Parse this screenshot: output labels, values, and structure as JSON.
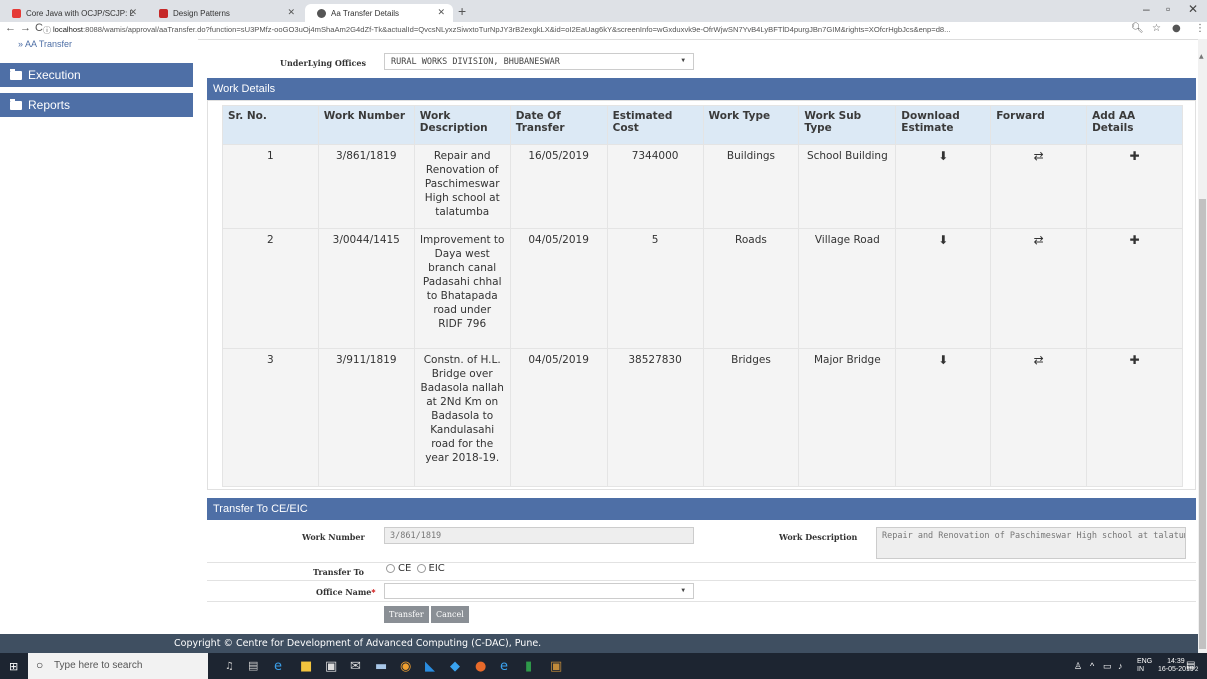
{
  "browser": {
    "tabs": [
      {
        "title": "Core Java with OCJP/SCJP: L",
        "color": "#e53935"
      },
      {
        "title": "Design Patterns",
        "color": "#c62828"
      },
      {
        "title": "Aa Transfer Details",
        "color": "#555555"
      }
    ],
    "new_tab": "+",
    "controls": {
      "minimize": "–",
      "maximize": "▫",
      "close": "✕"
    },
    "nav": {
      "back": "←",
      "forward": "→",
      "reload": "C"
    },
    "url_host": "localhost",
    "url_rest": ":8088/wamis/approval/aaTransfer.do?function=sU3PMfz-ooGO3uOj4mShaAm2G4dZf-Tk&actualId=QvcsNLyxzSiwxtoTurNpJY3rB2exgkLX&id=oI2EaUag6kY&screenInfo=wGxduxvk9e-OfrWjwSN7YvB4LyBFTlD4purgJBn7GIM&rights=XOfcrHgbJcs&enp=d8...",
    "info_icon": "ⓘ"
  },
  "sidebar": {
    "top_link": "» AA Transfer",
    "items": [
      {
        "label": "Execution"
      },
      {
        "label": "Reports"
      }
    ]
  },
  "underlying": {
    "label": "UnderLying Offices",
    "value": "RURAL WORKS DIVISION, BHUBANESWAR"
  },
  "work_details": {
    "heading": "Work Details",
    "columns": [
      "Sr. No.",
      "Work Number",
      "Work Description",
      "Date Of Transfer",
      "Estimated Cost",
      "Work Type",
      "Work Sub Type",
      "Download Estimate",
      "Forward",
      "Add AA Details"
    ],
    "rows": [
      {
        "sr": "1",
        "number": "3/861/1819",
        "description": "Repair and Renovation of Paschimeswar High school at talatumba",
        "date": "16/05/2019",
        "cost": "7344000",
        "type": "Buildings",
        "subtype": "School Building"
      },
      {
        "sr": "2",
        "number": "3/0044/1415",
        "description": "Improvement to Daya west branch canal Padasahi chhal to Bhatapada road under RIDF 796",
        "date": "04/05/2019",
        "cost": "5",
        "type": "Roads",
        "subtype": "Village Road"
      },
      {
        "sr": "3",
        "number": "3/911/1819",
        "description": "Constn. of H.L. Bridge over Badasola nallah at 2Nd Km on Badasola to Kandulasahi road for the year 2018-19.",
        "date": "04/05/2019",
        "cost": "38527830",
        "type": "Bridges",
        "subtype": "Major Bridge"
      }
    ],
    "icons": {
      "download": "download-icon",
      "forward": "transfer-icon",
      "add": "plus-icon"
    }
  },
  "transfer": {
    "heading": "Transfer To CE/EIC",
    "work_number_label": "Work Number",
    "work_number_value": "3/861/1819",
    "work_description_label": "Work Description",
    "work_description_value": "Repair and Renovation of Paschimeswar High school at talatumba",
    "transfer_to_label": "Transfer To",
    "options": [
      "CE",
      "EIC"
    ],
    "office_label": "Office Name",
    "required_mark": "*",
    "transfer_button": "Transfer",
    "cancel_button": "Cancel"
  },
  "footer": {
    "text": "Copyright © Centre for Development of Advanced Computing (C-DAC), Pune."
  },
  "taskbar": {
    "search_placeholder": "Type here to search",
    "lang_top": "ENG",
    "lang_bottom": "IN",
    "time": "14:39",
    "date": "16-05-2019",
    "notification_count": "2"
  },
  "colors": {
    "accent": "#4e6fa6",
    "header_row": "#dce9f5",
    "footer": "#3f4f61",
    "taskbar": "#1d2531"
  }
}
